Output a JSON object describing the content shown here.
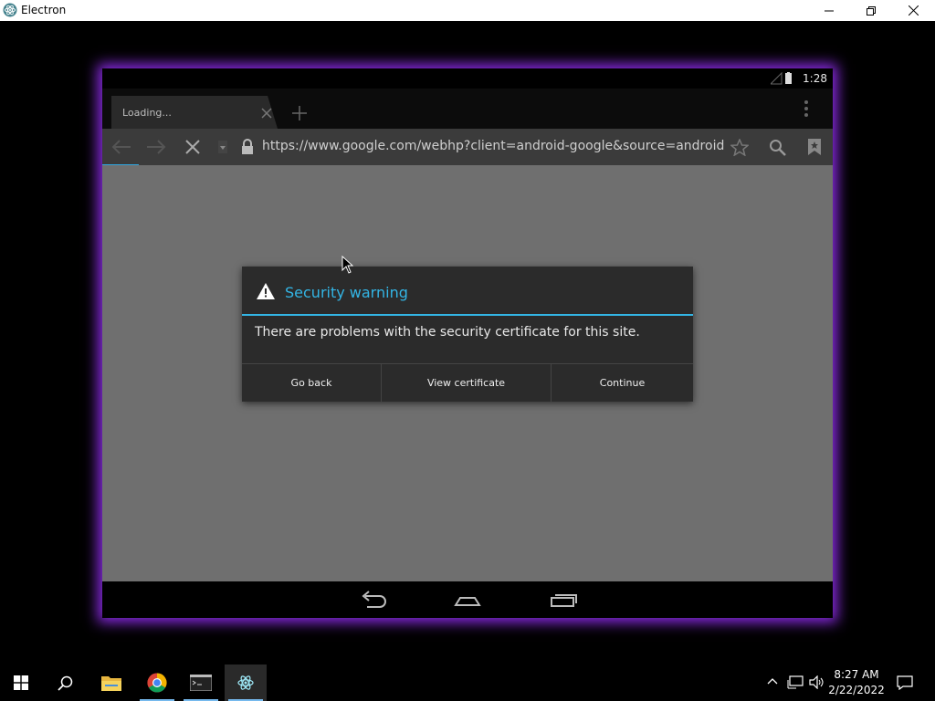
{
  "window": {
    "title": "Electron"
  },
  "android": {
    "status_time": "1:28",
    "tab": {
      "label": "Loading..."
    },
    "url": "https://www.google.com/webhp?client=android-google&source=android-l"
  },
  "dialog": {
    "title": "Security warning",
    "message": "There are problems with the security certificate for this site.",
    "buttons": [
      "Go back",
      "View certificate",
      "Continue"
    ]
  },
  "taskbar": {
    "time": "8:27 AM",
    "date": "2/22/2022"
  },
  "colors": {
    "accent": "#33b5e5",
    "glow": "#8a2be2"
  }
}
